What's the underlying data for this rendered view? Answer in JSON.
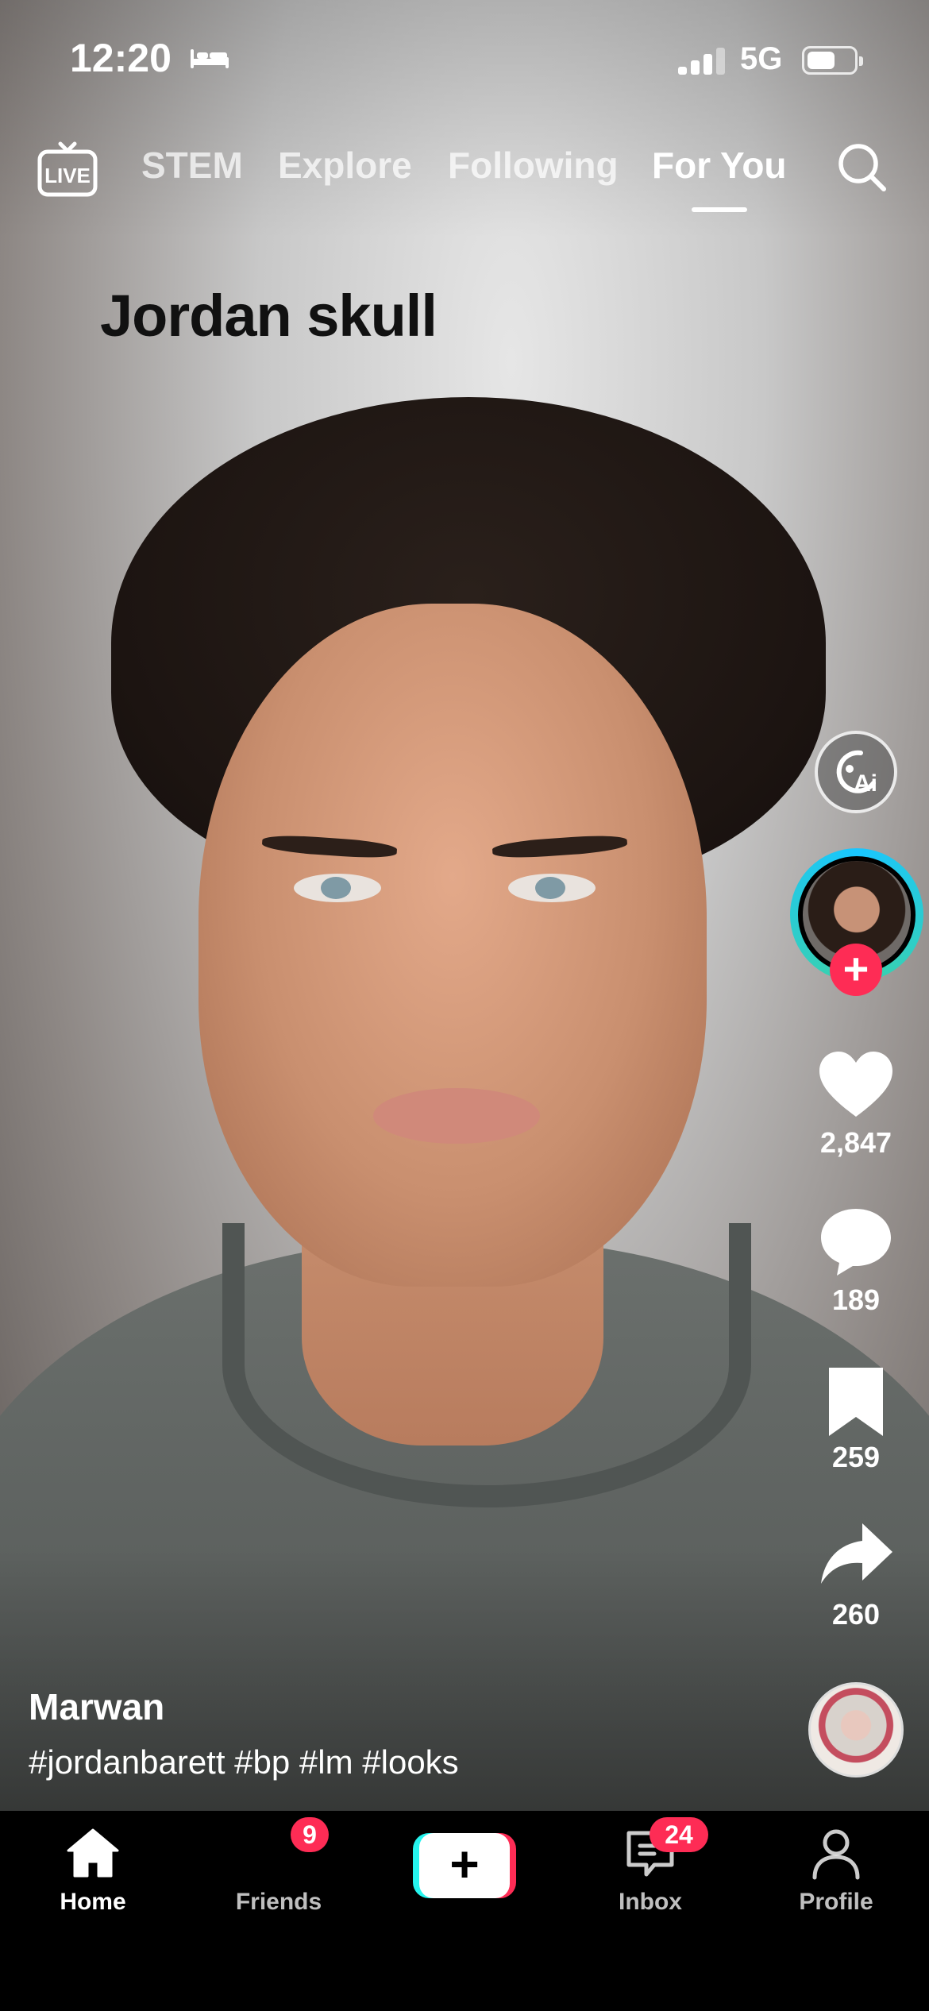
{
  "status_bar": {
    "time": "12:20",
    "network": "5G",
    "battery_level": 0.6,
    "signal_bars_lit": 3,
    "signal_bars_total": 4
  },
  "top_nav": {
    "live_label": "LIVE",
    "tabs": [
      {
        "label": "STEM",
        "active": false
      },
      {
        "label": "Explore",
        "active": false
      },
      {
        "label": "Following",
        "active": false
      },
      {
        "label": "For You",
        "active": true
      }
    ]
  },
  "video": {
    "overlay_text": "Jordan skull"
  },
  "actions": {
    "ai_label": "Ai",
    "likes": "2,847",
    "comments": "189",
    "saves": "259",
    "shares": "260"
  },
  "caption": {
    "author": "Marwan",
    "hashtags": "#jordanbarett #bp #lm #looks"
  },
  "bottom_nav": {
    "items": [
      {
        "label": "Home",
        "active": true
      },
      {
        "label": "Friends",
        "badge": "9"
      },
      {
        "label": "Inbox",
        "badge": "24"
      },
      {
        "label": "Profile"
      }
    ]
  },
  "colors": {
    "accent_red": "#fe2c55",
    "accent_cyan": "#25f4ee"
  }
}
